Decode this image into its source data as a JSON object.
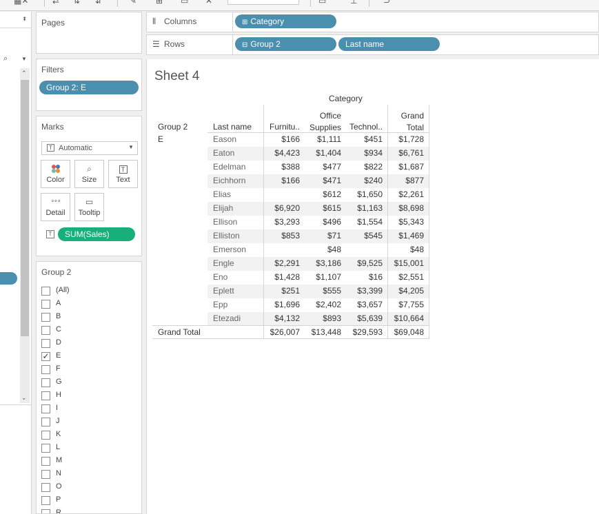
{
  "pages_title": "Pages",
  "filters": {
    "title": "Filters",
    "pill": "Group 2: E"
  },
  "marks": {
    "title": "Marks",
    "mark_type": "Automatic",
    "buttons": [
      "Color",
      "Size",
      "Text",
      "Detail",
      "Tooltip"
    ],
    "field_pill": "SUM(Sales)"
  },
  "group_filter": {
    "title": "Group 2",
    "items": [
      {
        "label": "(All)",
        "checked": false
      },
      {
        "label": "A",
        "checked": false
      },
      {
        "label": "B",
        "checked": false
      },
      {
        "label": "C",
        "checked": false
      },
      {
        "label": "D",
        "checked": false
      },
      {
        "label": "E",
        "checked": true
      },
      {
        "label": "F",
        "checked": false
      },
      {
        "label": "G",
        "checked": false
      },
      {
        "label": "H",
        "checked": false
      },
      {
        "label": "I",
        "checked": false
      },
      {
        "label": "J",
        "checked": false
      },
      {
        "label": "K",
        "checked": false
      },
      {
        "label": "L",
        "checked": false
      },
      {
        "label": "M",
        "checked": false
      },
      {
        "label": "N",
        "checked": false
      },
      {
        "label": "O",
        "checked": false
      },
      {
        "label": "P",
        "checked": false
      },
      {
        "label": "R",
        "checked": false
      }
    ]
  },
  "columns_shelf": {
    "label": "Columns",
    "pills": [
      "Category"
    ]
  },
  "rows_shelf": {
    "label": "Rows",
    "pills": [
      "Group 2",
      "Last name"
    ]
  },
  "sheet": {
    "title": "Sheet 4",
    "category_header": "Category",
    "group_header": "Group 2",
    "lastname_header": "Last name",
    "col_headers": [
      "Furnitu..",
      "Office Supplies",
      "Technol..",
      "Grand Total"
    ],
    "group_value": "E",
    "rows": [
      {
        "name": "Eason",
        "values": [
          "$166",
          "$1,111",
          "$451",
          "$1,728"
        ]
      },
      {
        "name": "Eaton",
        "values": [
          "$4,423",
          "$1,404",
          "$934",
          "$6,761"
        ]
      },
      {
        "name": "Edelman",
        "values": [
          "$388",
          "$477",
          "$822",
          "$1,687"
        ]
      },
      {
        "name": "Eichhorn",
        "values": [
          "$166",
          "$471",
          "$240",
          "$877"
        ]
      },
      {
        "name": "Elias",
        "values": [
          "",
          "$612",
          "$1,650",
          "$2,261"
        ]
      },
      {
        "name": "Elijah",
        "values": [
          "$6,920",
          "$615",
          "$1,163",
          "$8,698"
        ]
      },
      {
        "name": "Ellison",
        "values": [
          "$3,293",
          "$496",
          "$1,554",
          "$5,343"
        ]
      },
      {
        "name": "Elliston",
        "values": [
          "$853",
          "$71",
          "$545",
          "$1,469"
        ]
      },
      {
        "name": "Emerson",
        "values": [
          "",
          "$48",
          "",
          "$48"
        ]
      },
      {
        "name": "Engle",
        "values": [
          "$2,291",
          "$3,186",
          "$9,525",
          "$15,001"
        ]
      },
      {
        "name": "Eno",
        "values": [
          "$1,428",
          "$1,107",
          "$16",
          "$2,551"
        ]
      },
      {
        "name": "Eplett",
        "values": [
          "$251",
          "$555",
          "$3,399",
          "$4,205"
        ]
      },
      {
        "name": "Epp",
        "values": [
          "$1,696",
          "$2,402",
          "$3,657",
          "$7,755"
        ]
      },
      {
        "name": "Etezadi",
        "values": [
          "$4,132",
          "$893",
          "$5,639",
          "$10,664"
        ]
      }
    ],
    "grand_total_label": "Grand Total",
    "grand_total_values": [
      "$26,007",
      "$13,448",
      "$29,593",
      "$69,048"
    ]
  }
}
